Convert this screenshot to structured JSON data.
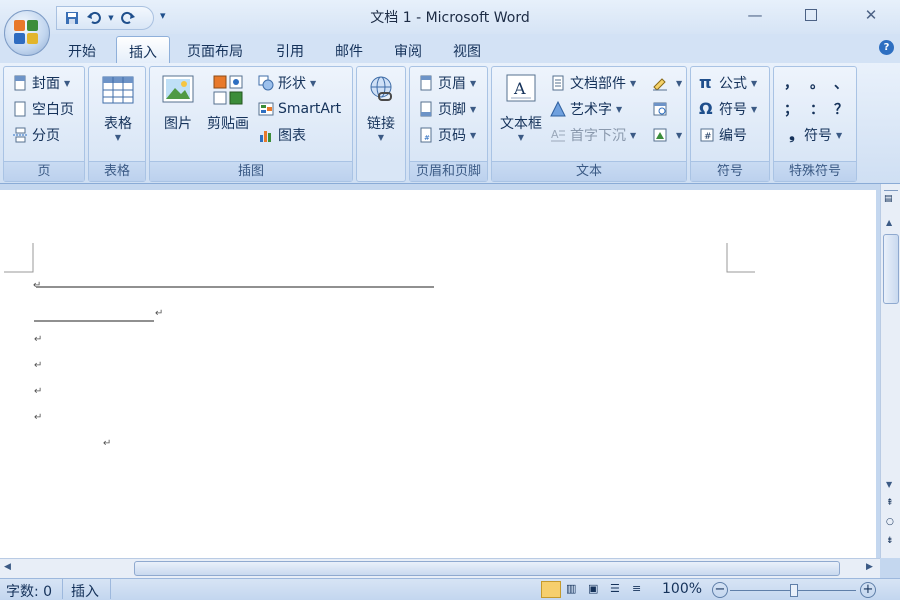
{
  "window": {
    "title": "文档 1 - Microsoft Word",
    "controls": [
      "minimize-icon",
      "maximize-icon",
      "close-icon"
    ]
  },
  "quick_access": {
    "icons": [
      "save-icon",
      "undo-icon",
      "redo-icon",
      "customize-qat-icon"
    ]
  },
  "tabs": [
    {
      "label": "开始",
      "active": false
    },
    {
      "label": "插入",
      "active": true
    },
    {
      "label": "页面布局",
      "active": false
    },
    {
      "label": "引用",
      "active": false
    },
    {
      "label": "邮件",
      "active": false
    },
    {
      "label": "审阅",
      "active": false
    },
    {
      "label": "视图",
      "active": false
    }
  ],
  "ribbon": {
    "page_group": {
      "label": "页",
      "cover": "封面",
      "blank": "空白页",
      "break": "分页"
    },
    "table_group": {
      "label": "表格",
      "table": "表格"
    },
    "illustration_group": {
      "label": "插图",
      "picture": "图片",
      "clipart": "剪贴画",
      "shapes": "形状",
      "smartart": "SmartArt",
      "chart": "图表"
    },
    "link_group": {
      "link": "链接"
    },
    "header_footer_group": {
      "label": "页眉和页脚",
      "header": "页眉",
      "footer": "页脚",
      "page_number": "页码"
    },
    "text_group": {
      "label": "文本",
      "textbox": "文本框",
      "quickparts": "文档部件",
      "wordart": "艺术字",
      "dropcap": "首字下沉"
    },
    "symbol_group": {
      "label": "符号",
      "equation": "公式",
      "symbol": "符号",
      "numbering": "编号"
    },
    "special_group": {
      "label": "特殊符号",
      "chars": [
        "，",
        "。",
        "、",
        "；",
        "：",
        "？"
      ],
      "symbol": "符号"
    }
  },
  "document": {
    "paragraph_mark": "↵"
  },
  "status": {
    "word_count": "字数: 0",
    "mode": "插入",
    "zoom": "100%"
  },
  "colors": {
    "accent": "#2e6fc1",
    "ribbon_bg": "#d9e6f6",
    "page": "#ffffff"
  }
}
